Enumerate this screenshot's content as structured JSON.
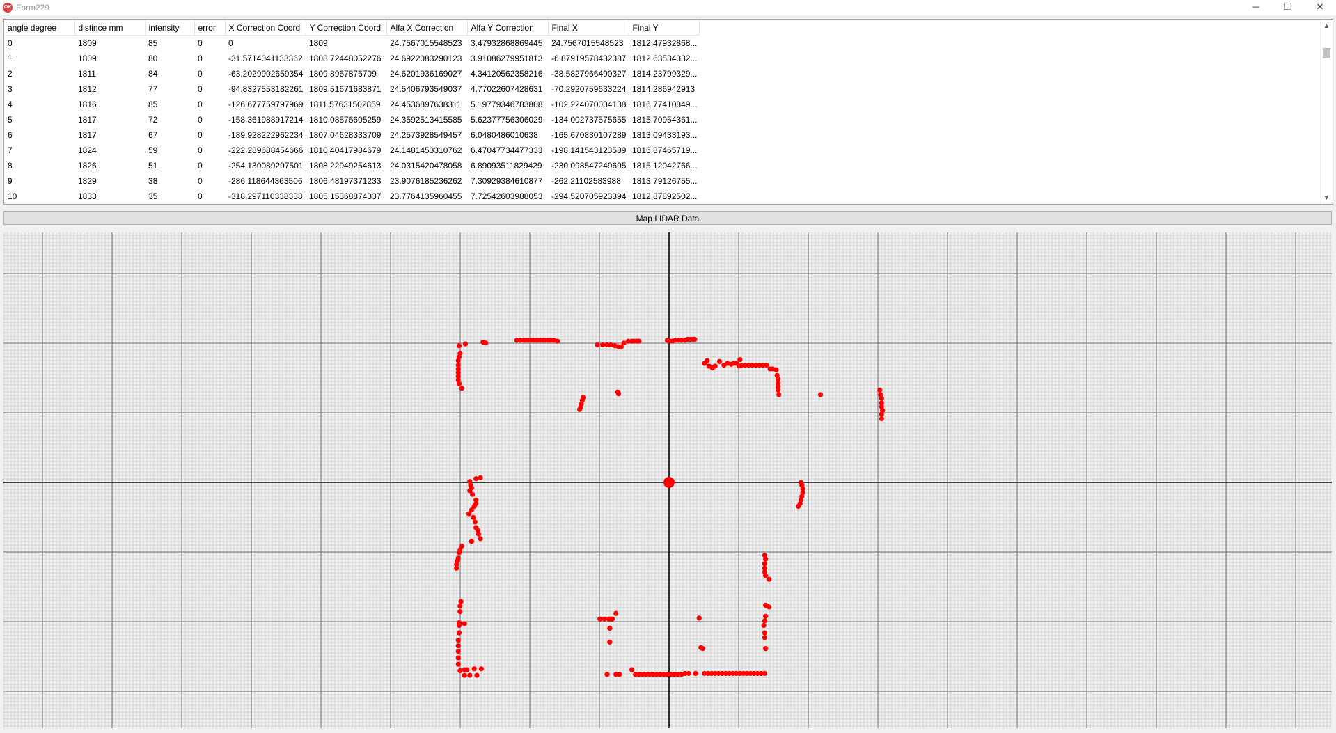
{
  "window": {
    "title": "Form229",
    "icon_label": "OK",
    "minimize": "─",
    "restore": "❐",
    "close": "✕"
  },
  "table": {
    "columns": [
      "angle degree",
      "distince mm",
      "intensity",
      "error",
      "X Correction Coord",
      "Y Correction Coord",
      "Alfa X Correction",
      "Alfa Y Correction",
      "Final X",
      "Final Y"
    ],
    "rows": [
      [
        "0",
        "1809",
        "85",
        "0",
        "0",
        "1809",
        "24.7567015548523",
        "3.47932868869445",
        "24.7567015548523",
        "1812.47932868..."
      ],
      [
        "1",
        "1809",
        "80",
        "0",
        "-31.5714041133362",
        "1808.72448052276",
        "24.6922083290123",
        "3.91086279951813",
        "-6.87919578432387",
        "1812.63534332..."
      ],
      [
        "2",
        "1811",
        "84",
        "0",
        "-63.2029902659354",
        "1809.8967876709",
        "24.6201936169027",
        "4.34120562358216",
        "-38.5827966490327",
        "1814.23799329..."
      ],
      [
        "3",
        "1812",
        "77",
        "0",
        "-94.8327553182261",
        "1809.51671683871",
        "24.5406793549037",
        "4.77022607428631",
        "-70.2920759633224",
        "1814.286942913"
      ],
      [
        "4",
        "1816",
        "85",
        "0",
        "-126.677759797969",
        "1811.57631502859",
        "24.4536897638311",
        "5.19779346783808",
        "-102.224070034138",
        "1816.77410849..."
      ],
      [
        "5",
        "1817",
        "72",
        "0",
        "-158.361988917214",
        "1810.08576605259",
        "24.3592513415585",
        "5.62377756306029",
        "-134.002737575655",
        "1815.70954361..."
      ],
      [
        "6",
        "1817",
        "67",
        "0",
        "-189.928222962234",
        "1807.04628333709",
        "24.2573928549457",
        "6.0480486010638",
        "-165.670830107289",
        "1813.09433193..."
      ],
      [
        "7",
        "1824",
        "59",
        "0",
        "-222.289688454666",
        "1810.40417984679",
        "24.1481453310762",
        "6.47047734477333",
        "-198.141543123589",
        "1816.87465719..."
      ],
      [
        "8",
        "1826",
        "51",
        "0",
        "-254.130089297501",
        "1808.22949254613",
        "24.0315420478058",
        "6.89093511829429",
        "-230.098547249695",
        "1815.12042766..."
      ],
      [
        "9",
        "1829",
        "38",
        "0",
        "-286.118644363506",
        "1806.48197371233",
        "23.9076185236262",
        "7.30929384610877",
        "-262.21102583988",
        "1813.79126755..."
      ],
      [
        "10",
        "1833",
        "35",
        "0",
        "-318.297110338338",
        "1805.15368874337",
        "23.7764135960455",
        "7.72542603988053",
        "-294.520705923394",
        "1812.87892502..."
      ]
    ]
  },
  "scroll": {
    "up": "▲",
    "down": "▼"
  },
  "map_button": "Map LIDAR Data",
  "chart_data": {
    "type": "scatter",
    "title": "",
    "xlabel": "",
    "ylabel": "",
    "xlim": [
      -775,
      725
    ],
    "ylim": [
      -275,
      262
    ],
    "grid": true,
    "axes_at_origin": true,
    "point_color": "#ff0000",
    "origin_marker": true,
    "points": [
      [
        -237,
        148
      ],
      [
        -230,
        150
      ],
      [
        -210,
        152
      ],
      [
        -207,
        151
      ],
      [
        -172,
        154
      ],
      [
        -168,
        154
      ],
      [
        -164,
        154
      ],
      [
        -162,
        154
      ],
      [
        -159,
        154
      ],
      [
        -156,
        154
      ],
      [
        -153,
        154
      ],
      [
        -150,
        154
      ],
      [
        -148,
        154
      ],
      [
        -145,
        154
      ],
      [
        -142,
        154
      ],
      [
        -140,
        154
      ],
      [
        -137,
        154
      ],
      [
        -135,
        154
      ],
      [
        -133,
        154
      ],
      [
        -130,
        154
      ],
      [
        -126,
        153
      ],
      [
        -81,
        149
      ],
      [
        -75,
        149
      ],
      [
        -70,
        149
      ],
      [
        -66,
        149
      ],
      [
        -61,
        148
      ],
      [
        -57,
        147
      ],
      [
        -54,
        147
      ],
      [
        -51,
        151
      ],
      [
        -46,
        153
      ],
      [
        -42,
        153
      ],
      [
        -40,
        153
      ],
      [
        -37,
        153
      ],
      [
        -35,
        153
      ],
      [
        -34,
        153
      ],
      [
        -2,
        154
      ],
      [
        1,
        153
      ],
      [
        4,
        153
      ],
      [
        7,
        154
      ],
      [
        11,
        154
      ],
      [
        14,
        154
      ],
      [
        18,
        154
      ],
      [
        21,
        155
      ],
      [
        24,
        155
      ],
      [
        27,
        155
      ],
      [
        29,
        155
      ],
      [
        -236,
        140
      ],
      [
        -237,
        136
      ],
      [
        -238,
        132
      ],
      [
        -238,
        127
      ],
      [
        -238,
        123
      ],
      [
        -238,
        119
      ],
      [
        -238,
        115
      ],
      [
        -238,
        111
      ],
      [
        -237,
        107
      ],
      [
        -234,
        102
      ],
      [
        40,
        129
      ],
      [
        43,
        132
      ],
      [
        45,
        126
      ],
      [
        49,
        124
      ],
      [
        52,
        126
      ],
      [
        57,
        131
      ],
      [
        62,
        127
      ],
      [
        66,
        129
      ],
      [
        70,
        128
      ],
      [
        73,
        129
      ],
      [
        76,
        129
      ],
      [
        79,
        126
      ],
      [
        80,
        133
      ],
      [
        82,
        127
      ],
      [
        86,
        127
      ],
      [
        90,
        127
      ],
      [
        94,
        127
      ],
      [
        98,
        127
      ],
      [
        102,
        127
      ],
      [
        106,
        127
      ],
      [
        110,
        127
      ],
      [
        114,
        123
      ],
      [
        117,
        123
      ],
      [
        121,
        122
      ],
      [
        117,
        123
      ],
      [
        121,
        122
      ],
      [
        122,
        116
      ],
      [
        123,
        112
      ],
      [
        123,
        108
      ],
      [
        123,
        104
      ],
      [
        123,
        100
      ],
      [
        124,
        95
      ],
      [
        171,
        95
      ],
      [
        238,
        100
      ],
      [
        239,
        95
      ],
      [
        240,
        91
      ],
      [
        240,
        86
      ],
      [
        240,
        82
      ],
      [
        241,
        78
      ],
      [
        240,
        74
      ],
      [
        240,
        69
      ],
      [
        -58,
        98
      ],
      [
        -57,
        96
      ],
      [
        -97,
        92
      ],
      [
        -98,
        89
      ],
      [
        -99,
        85
      ],
      [
        -100,
        81
      ],
      [
        -101,
        79
      ],
      [
        -213,
        5
      ],
      [
        -218,
        4
      ],
      [
        -225,
        1
      ],
      [
        -224,
        -3
      ],
      [
        -223,
        -6
      ],
      [
        -225,
        -9
      ],
      [
        -222,
        -13
      ],
      [
        -218,
        -19
      ],
      [
        -218,
        -23
      ],
      [
        -220,
        -26
      ],
      [
        -223,
        -30
      ],
      [
        -226,
        -34
      ],
      [
        -221,
        -38
      ],
      [
        -219,
        -43
      ],
      [
        -218,
        -49
      ],
      [
        -216,
        -52
      ],
      [
        -215,
        -56
      ],
      [
        -213,
        -61
      ],
      [
        -223,
        -64
      ],
      [
        -234,
        -69
      ],
      [
        -236,
        -73
      ],
      [
        -237,
        -76
      ],
      [
        -238,
        -82
      ],
      [
        -239,
        -85
      ],
      [
        -240,
        -89
      ],
      [
        -240,
        -93
      ],
      [
        -235,
        -129
      ],
      [
        -236,
        -134
      ],
      [
        -236,
        -140
      ],
      [
        -231,
        -153
      ],
      [
        -237,
        -152
      ],
      [
        -237,
        -155
      ],
      [
        -237,
        -163
      ],
      [
        -238,
        -171
      ],
      [
        -238,
        -177
      ],
      [
        -238,
        -183
      ],
      [
        -238,
        -190
      ],
      [
        -238,
        -197
      ],
      [
        -236,
        -204
      ],
      [
        -231,
        -209
      ],
      [
        -225,
        -209
      ],
      [
        -217,
        -209
      ],
      [
        -231,
        -203
      ],
      [
        -228,
        -203
      ],
      [
        -220,
        -202
      ],
      [
        -212,
        -202
      ],
      [
        149,
        0
      ],
      [
        150,
        -3
      ],
      [
        151,
        -7
      ],
      [
        151,
        -11
      ],
      [
        150,
        -15
      ],
      [
        149,
        -19
      ],
      [
        148,
        -23
      ],
      [
        146,
        -26
      ],
      [
        108,
        -79
      ],
      [
        109,
        -83
      ],
      [
        108,
        -88
      ],
      [
        108,
        -93
      ],
      [
        108,
        -97
      ],
      [
        109,
        -101
      ],
      [
        113,
        -105
      ],
      [
        109,
        -133
      ],
      [
        111,
        -134
      ],
      [
        113,
        -135
      ],
      [
        109,
        -145
      ],
      [
        108,
        -150
      ],
      [
        107,
        -155
      ],
      [
        108,
        -163
      ],
      [
        108,
        -168
      ],
      [
        109,
        -180
      ],
      [
        -78,
        -148
      ],
      [
        -73,
        -148
      ],
      [
        -68,
        -148
      ],
      [
        -66,
        -148
      ],
      [
        -64,
        -148
      ],
      [
        -60,
        -142
      ],
      [
        -67,
        -158
      ],
      [
        -67,
        -173
      ],
      [
        -70,
        -208
      ],
      [
        -60,
        -208
      ],
      [
        -56,
        -208
      ],
      [
        -42,
        -203
      ],
      [
        -38,
        -208
      ],
      [
        -34,
        -208
      ],
      [
        -30,
        -208
      ],
      [
        -26,
        -208
      ],
      [
        -22,
        -208
      ],
      [
        -18,
        -208
      ],
      [
        -14,
        -208
      ],
      [
        -10,
        -208
      ],
      [
        -6,
        -208
      ],
      [
        -2,
        -208
      ],
      [
        2,
        -208
      ],
      [
        6,
        -208
      ],
      [
        10,
        -208
      ],
      [
        14,
        -208
      ],
      [
        18,
        -207
      ],
      [
        22,
        -207
      ],
      [
        30,
        -207
      ],
      [
        36,
        -179
      ],
      [
        38,
        -180
      ],
      [
        34,
        -147
      ],
      [
        40,
        -207
      ],
      [
        44,
        -207
      ],
      [
        48,
        -207
      ],
      [
        52,
        -207
      ],
      [
        56,
        -207
      ],
      [
        60,
        -207
      ],
      [
        64,
        -207
      ],
      [
        68,
        -207
      ],
      [
        72,
        -207
      ],
      [
        76,
        -207
      ],
      [
        80,
        -207
      ],
      [
        84,
        -207
      ],
      [
        88,
        -207
      ],
      [
        92,
        -207
      ],
      [
        96,
        -207
      ],
      [
        100,
        -207
      ],
      [
        104,
        -207
      ],
      [
        108,
        -207
      ]
    ]
  }
}
